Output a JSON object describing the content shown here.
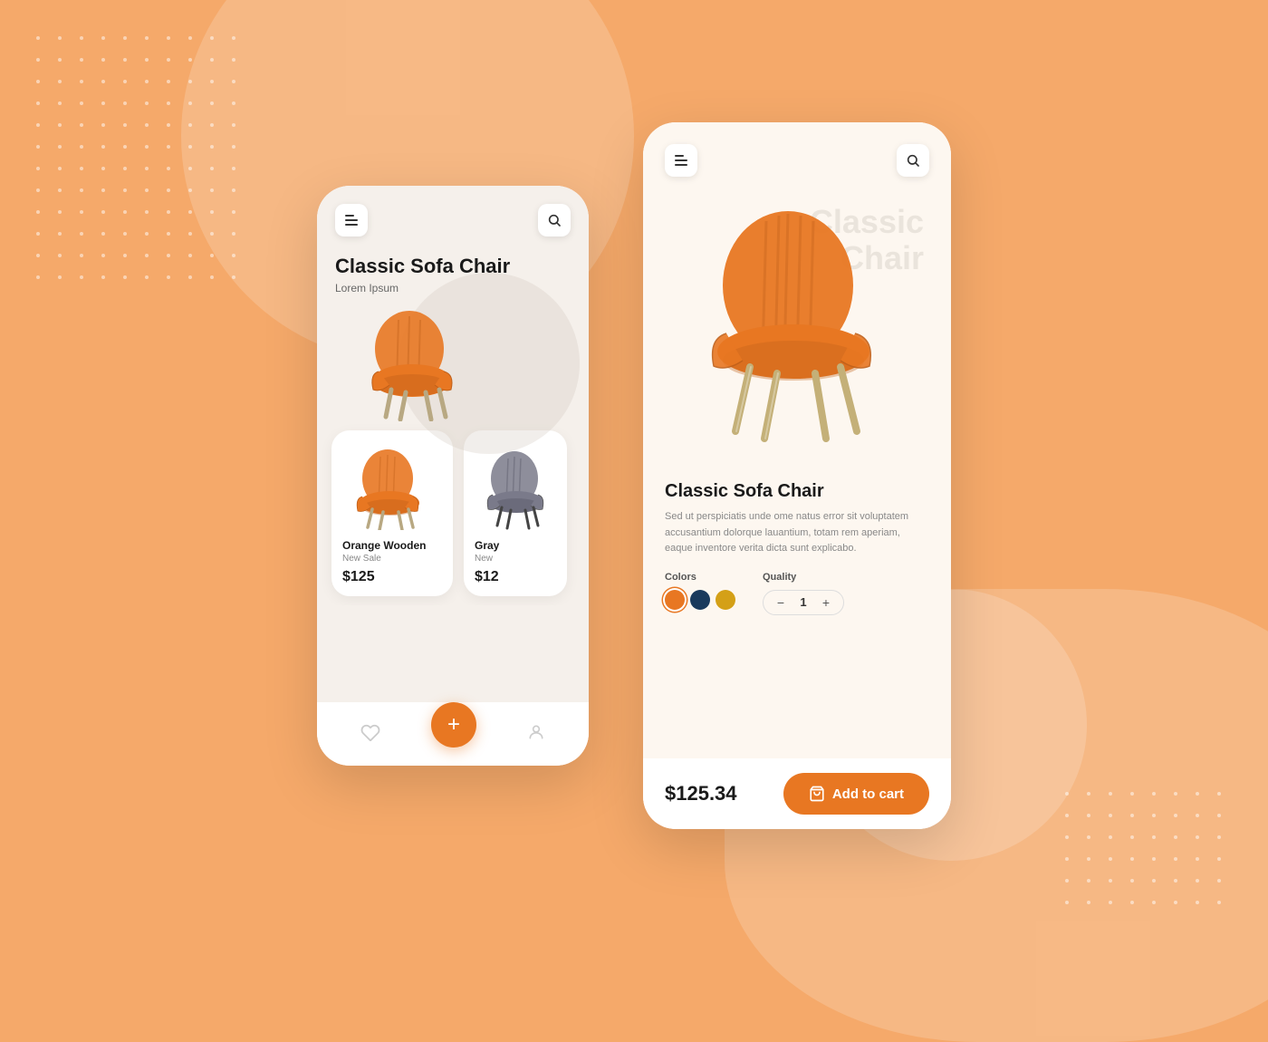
{
  "background": {
    "color": "#F5A96A"
  },
  "phone1": {
    "header": {
      "menu_label": "menu",
      "search_label": "search"
    },
    "hero": {
      "title": "Classic Sofa Chair",
      "subtitle": "Lorem Ipsum"
    },
    "cards": [
      {
        "name": "Orange Wooden",
        "tag": "New Sale",
        "price": "$125",
        "color": "orange"
      },
      {
        "name": "Gray",
        "tag": "New",
        "price": "$12",
        "color": "gray"
      }
    ],
    "nav": {
      "plus_label": "+",
      "heart_label": "♡",
      "user_label": "👤"
    }
  },
  "phone2": {
    "header": {
      "menu_label": "menu",
      "search_label": "search"
    },
    "hero": {
      "bg_title_line1": "Classic",
      "bg_title_line2": "Chair"
    },
    "product": {
      "name": "Classic Sofa Chair",
      "description": "Sed ut perspiciatis unde ome natus error sit voluptatem accusantium dolorque lauantium, totam rem aperiam, eaque inventore verita dicta sunt explicabo.",
      "colors_label": "Colors",
      "quality_label": "Quality",
      "colors": [
        {
          "hex": "#E87722",
          "active": true
        },
        {
          "hex": "#1a3a5c",
          "active": false
        },
        {
          "hex": "#d4a017",
          "active": false
        }
      ],
      "quantity": 1
    },
    "bottom": {
      "price": "$125.34",
      "add_to_cart": "Add to cart"
    }
  }
}
